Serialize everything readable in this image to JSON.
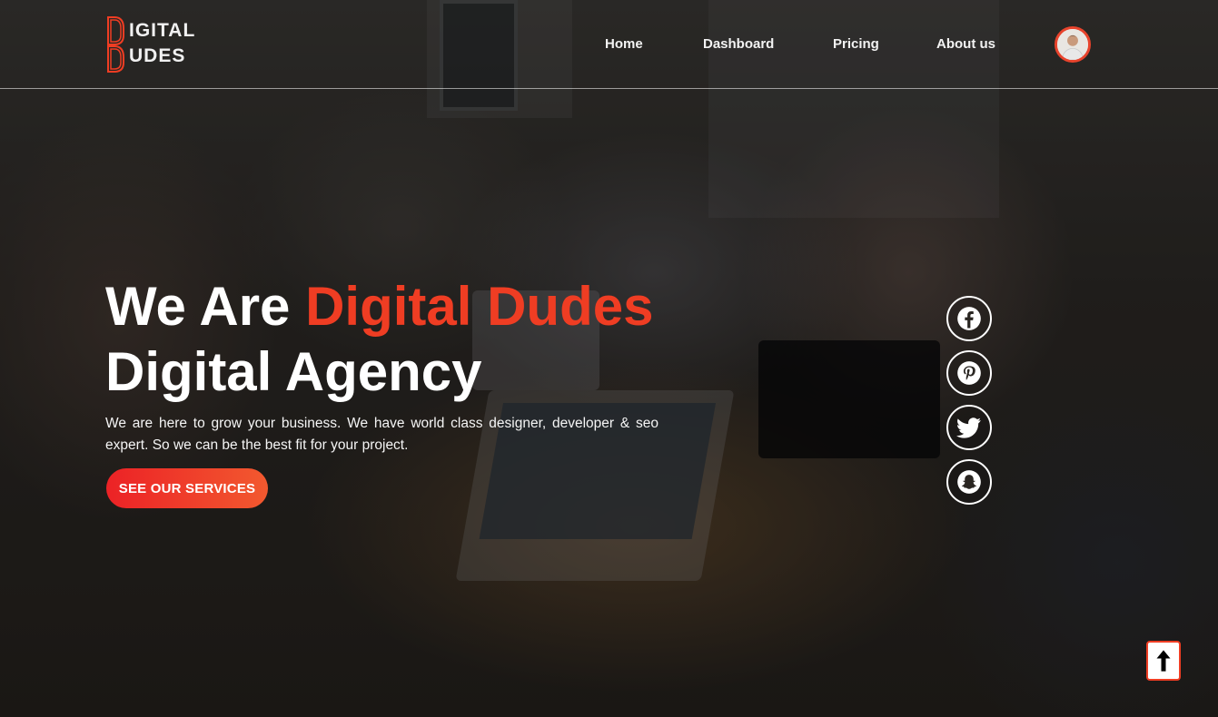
{
  "brand": {
    "line1": "IGITAL",
    "line2": "UDES",
    "accent_color": "#ef3d23"
  },
  "nav": {
    "items": [
      {
        "label": "Home"
      },
      {
        "label": "Dashboard"
      },
      {
        "label": "Pricing"
      },
      {
        "label": "About us"
      }
    ]
  },
  "user": {
    "avatar_icon": "user-avatar"
  },
  "hero": {
    "title_part1": "We Are ",
    "title_accent": "Digital Dudes",
    "title_line2": "Digital Agency",
    "description": "We are here to grow your business. We have world class designer, developer & seo expert. So we can be the best fit for your project.",
    "cta_label": "SEE OUR SERVICES",
    "cta_gradient": [
      "#ec2226",
      "#f2592f"
    ]
  },
  "social": {
    "icons": [
      "facebook-icon",
      "pinterest-icon",
      "twitter-icon",
      "snapchat-icon"
    ]
  },
  "back_to_top": {
    "icon": "arrow-up-icon"
  }
}
